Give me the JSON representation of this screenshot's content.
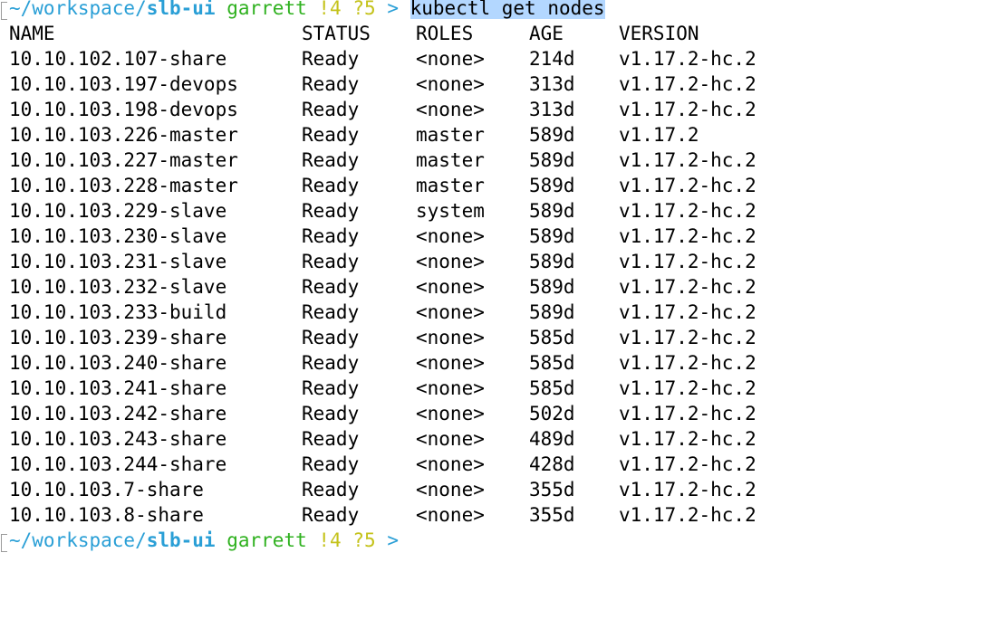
{
  "prompt": {
    "path": "~/workspace/",
    "repo": "slb-ui",
    "user": "garrett",
    "status_modified": "!4",
    "status_untracked": "?5",
    "symbol": ">"
  },
  "command": {
    "highlighted": "kubectl get nodes"
  },
  "table": {
    "headers": [
      "NAME",
      "STATUS",
      "ROLES",
      "AGE",
      "VERSION"
    ],
    "rows": [
      [
        "10.10.102.107-share",
        "Ready",
        "<none>",
        "214d",
        "v1.17.2-hc.2"
      ],
      [
        "10.10.103.197-devops",
        "Ready",
        "<none>",
        "313d",
        "v1.17.2-hc.2"
      ],
      [
        "10.10.103.198-devops",
        "Ready",
        "<none>",
        "313d",
        "v1.17.2-hc.2"
      ],
      [
        "10.10.103.226-master",
        "Ready",
        "master",
        "589d",
        "v1.17.2"
      ],
      [
        "10.10.103.227-master",
        "Ready",
        "master",
        "589d",
        "v1.17.2-hc.2"
      ],
      [
        "10.10.103.228-master",
        "Ready",
        "master",
        "589d",
        "v1.17.2-hc.2"
      ],
      [
        "10.10.103.229-slave",
        "Ready",
        "system",
        "589d",
        "v1.17.2-hc.2"
      ],
      [
        "10.10.103.230-slave",
        "Ready",
        "<none>",
        "589d",
        "v1.17.2-hc.2"
      ],
      [
        "10.10.103.231-slave",
        "Ready",
        "<none>",
        "589d",
        "v1.17.2-hc.2"
      ],
      [
        "10.10.103.232-slave",
        "Ready",
        "<none>",
        "589d",
        "v1.17.2-hc.2"
      ],
      [
        "10.10.103.233-build",
        "Ready",
        "<none>",
        "589d",
        "v1.17.2-hc.2"
      ],
      [
        "10.10.103.239-share",
        "Ready",
        "<none>",
        "585d",
        "v1.17.2-hc.2"
      ],
      [
        "10.10.103.240-share",
        "Ready",
        "<none>",
        "585d",
        "v1.17.2-hc.2"
      ],
      [
        "10.10.103.241-share",
        "Ready",
        "<none>",
        "585d",
        "v1.17.2-hc.2"
      ],
      [
        "10.10.103.242-share",
        "Ready",
        "<none>",
        "502d",
        "v1.17.2-hc.2"
      ],
      [
        "10.10.103.243-share",
        "Ready",
        "<none>",
        "489d",
        "v1.17.2-hc.2"
      ],
      [
        "10.10.103.244-share",
        "Ready",
        "<none>",
        "428d",
        "v1.17.2-hc.2"
      ],
      [
        "10.10.103.7-share",
        "Ready",
        "<none>",
        "355d",
        "v1.17.2-hc.2"
      ],
      [
        "10.10.103.8-share",
        "Ready",
        "<none>",
        "355d",
        "v1.17.2-hc.2"
      ]
    ]
  },
  "colors": {
    "path": "#2a9fd6",
    "user": "#2fb11f",
    "git_status": "#c4c21a",
    "selection": "#b3d7ff"
  }
}
